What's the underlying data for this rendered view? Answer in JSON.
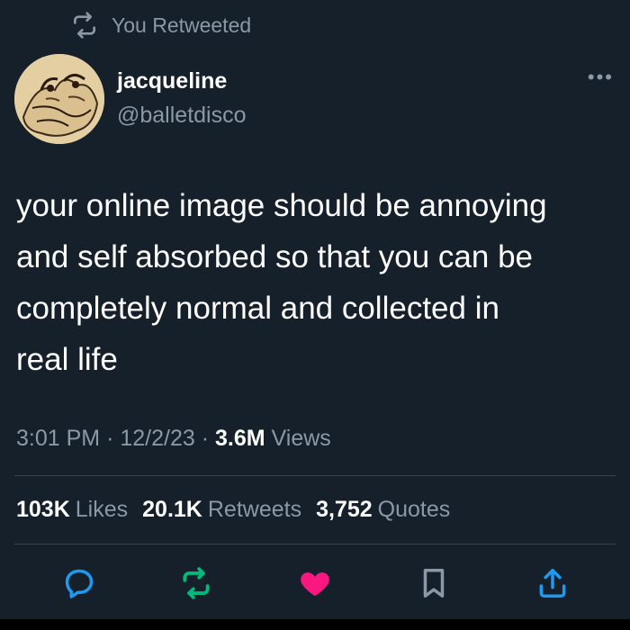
{
  "retweet_indicator": {
    "label": "You Retweeted",
    "icon": "retweet-icon"
  },
  "author": {
    "display_name": "jacqueline",
    "handle": "@balletdisco",
    "avatar": "avatar"
  },
  "more_menu": {
    "label": "•••",
    "icon": "more-icon"
  },
  "tweet": {
    "text": "your online image should be annoying\nand self absorbed so that you can be\ncompletely normal and collected in\nreal life"
  },
  "meta": {
    "time": "3:01 PM",
    "date": "12/2/23",
    "views_count": "3.6M",
    "views_label": "Views"
  },
  "stats": [
    {
      "count": "103K",
      "label": "Likes"
    },
    {
      "count": "20.1K",
      "label": "Retweets"
    },
    {
      "count": "3,752",
      "label": "Quotes"
    }
  ],
  "actions": [
    {
      "name": "reply",
      "icon": "reply-icon",
      "color": "#1d9bf0"
    },
    {
      "name": "retweet",
      "icon": "retweet-icon",
      "color": "#00ba7c"
    },
    {
      "name": "like",
      "icon": "heart-icon",
      "color": "#f91880"
    },
    {
      "name": "bookmark",
      "icon": "bookmark-icon",
      "color": "#8b98a5"
    },
    {
      "name": "share",
      "icon": "share-icon",
      "color": "#1d9bf0"
    }
  ],
  "colors": {
    "background": "#15202b",
    "secondary_text": "#8b98a5",
    "divider": "#38444d"
  }
}
